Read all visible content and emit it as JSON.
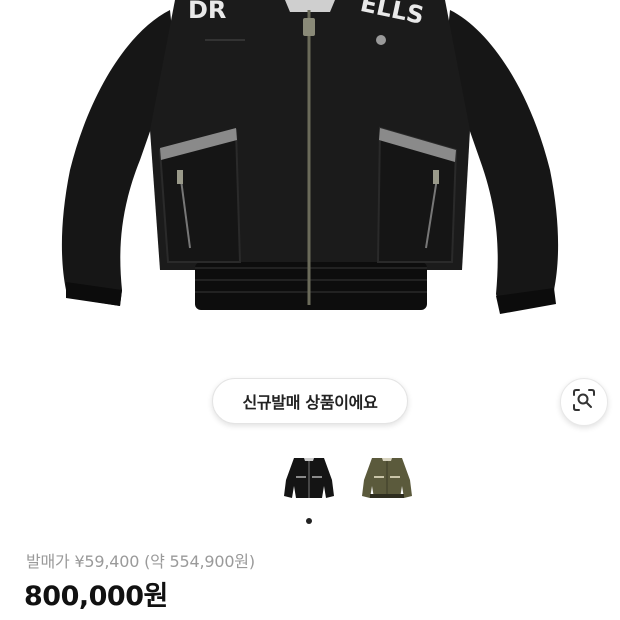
{
  "product": {
    "new_badge": "신규발매 상품이에요",
    "jacket_text_left": "DR",
    "jacket_text_right": "ELLS",
    "original_price": "발매가 ¥59,400 (약 554,900원)",
    "price": "800,000원"
  },
  "colors": {
    "jacket_black": "#141414",
    "jacket_olive": "#5b5a3c",
    "pocket_trim": "#8a8a8a"
  },
  "icons": {
    "lens": "lens-search-icon"
  },
  "gallery": {
    "thumbnails": [
      "black",
      "olive"
    ],
    "active_index": 0
  }
}
